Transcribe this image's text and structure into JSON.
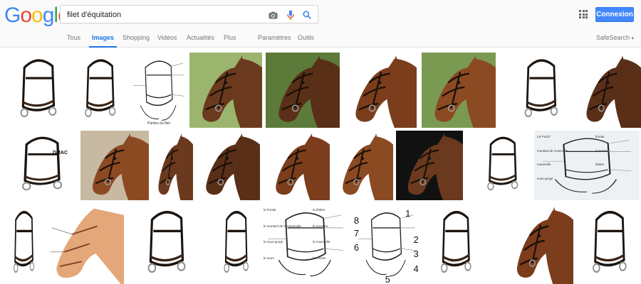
{
  "logo": {
    "text": "Google",
    "letters": [
      {
        "ch": "G",
        "color": "#4285F4"
      },
      {
        "ch": "o",
        "color": "#EA4335"
      },
      {
        "ch": "o",
        "color": "#FBBC05"
      },
      {
        "ch": "g",
        "color": "#4285F4"
      },
      {
        "ch": "l",
        "color": "#34A853"
      },
      {
        "ch": "e",
        "color": "#EA4335"
      }
    ]
  },
  "search": {
    "query": "filet d'équitation"
  },
  "header": {
    "signin_label": "Connexion",
    "safesearch_label": "SafeSearch"
  },
  "tabs": [
    {
      "label": "Tous"
    },
    {
      "label": "Images"
    },
    {
      "label": "Shopping"
    },
    {
      "label": "Vidéos"
    },
    {
      "label": "Actualités"
    },
    {
      "label": "Plus"
    },
    {
      "label": "Paramètres"
    },
    {
      "label": "Outils"
    }
  ],
  "colors": {
    "accent": "#1a73e8",
    "button": "#4387fd"
  },
  "results": [
    {
      "kind": "bridle-product",
      "bg": "#ffffff"
    },
    {
      "kind": "bridle-product",
      "bg": "#ffffff"
    },
    {
      "kind": "bridle-diagram",
      "bg": "#ffffff",
      "caption": "Parties du filet"
    },
    {
      "kind": "horse-photo",
      "bg": "#9cb56e"
    },
    {
      "kind": "horse-photo",
      "bg": "#5c7a3a"
    },
    {
      "kind": "horse-photo",
      "bg": "#ffffff"
    },
    {
      "kind": "horse-photo",
      "bg": "#7a9a52"
    },
    {
      "kind": "bridle-product",
      "bg": "#ffffff"
    },
    {
      "kind": "horse-photo",
      "bg": "#ffffff"
    },
    {
      "kind": "bridle-product",
      "bg": "#ffffff",
      "brand": "DMAC"
    },
    {
      "kind": "horse-photo",
      "bg": "#c7b9a2"
    },
    {
      "kind": "horse-photo",
      "bg": "#ffffff"
    },
    {
      "kind": "horse-photo",
      "bg": "#ffffff"
    },
    {
      "kind": "horse-photo",
      "bg": "#ffffff"
    },
    {
      "kind": "horse-photo",
      "bg": "#ffffff"
    },
    {
      "kind": "horse-photo",
      "bg": "#111111"
    },
    {
      "kind": "bridle-product",
      "bg": "#ffffff"
    },
    {
      "kind": "labeled-diagram",
      "bg": "#eef1f3",
      "labels": [
        "LE FILET",
        "frontal",
        "montant de muserolle",
        "montant",
        "muserolle",
        "têtière",
        "sous-gorge"
      ]
    },
    {
      "kind": "bridle-product",
      "bg": "#ffffff"
    },
    {
      "kind": "horse-illustration",
      "bg": "#ffffff"
    },
    {
      "kind": "bridle-product",
      "bg": "#ffffff"
    },
    {
      "kind": "bridle-product",
      "bg": "#ffffff"
    },
    {
      "kind": "bridle-diagram",
      "bg": "#ffffff",
      "labels": [
        "le frontal",
        "la têtière",
        "le montant de la muserolle",
        "le montant",
        "la sous-gorge",
        "la muserolle",
        "le mors",
        "les rênes"
      ]
    },
    {
      "kind": "numbered-diagram",
      "bg": "#ffffff",
      "numbers": [
        "1",
        "2",
        "3",
        "4",
        "5",
        "6",
        "7",
        "8"
      ]
    },
    {
      "kind": "bridle-product",
      "bg": "#ffffff"
    },
    {
      "kind": "horse-photo",
      "bg": "#ffffff"
    },
    {
      "kind": "bridle-product",
      "bg": "#ffffff"
    }
  ]
}
